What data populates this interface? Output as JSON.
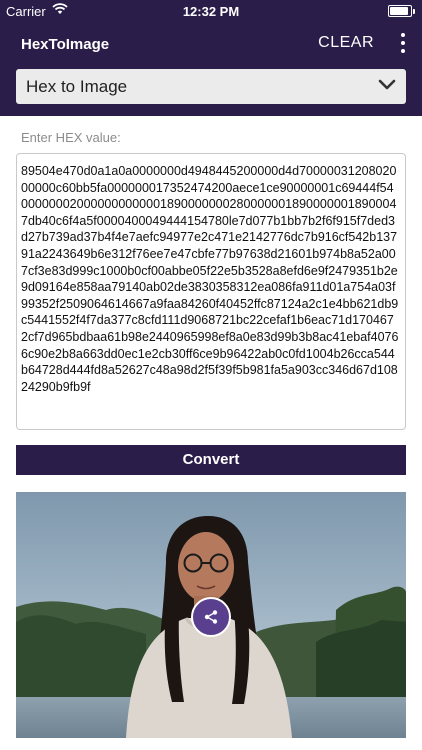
{
  "status_bar": {
    "carrier": "Carrier",
    "time": "12:32 PM",
    "battery_level": 0.9
  },
  "app_bar": {
    "title": "HexToImage",
    "clear_label": "CLEAR",
    "menu_icon": "more-vertical-icon"
  },
  "mode_select": {
    "selected": "Hex to Image",
    "icon": "chevron-down-icon"
  },
  "hex_input": {
    "label": "Enter HEX value:",
    "value": "89504e470d0a1a0a0000000d4948445200000d4d7000003120802000000c60bb5fa000000017352474200aece1ce90000001c69444f540000000200000000000018900000002800000018900000018900047db40c6f4a5f0000400049444154780le7d077b1bb7b2f6f915f7ded3d27b739ad37b4f4e7aefc94977e2c471e2142776dc7b916cf542b13791a2243649b6e312f76ee7e47cbfe77b97638d21601b974b8a52a007cf3e83d999c1000b0cf00abbe05f22e5b3528a8efd6e9f2479351b2e9d09164e858aa79140ab02de3830358312ea086fa911d01a754a03f99352f2509064614667a9faa84260f40452ffc87124a2c1e4bb621db9c5441552f4f7da377c8cfd111d9068721bc22cefaf1b6eac71d1704672cf7d965bdbaa61b98e2440965998ef8a0e83d99b3b8ac41ebaf40766c90e2b8a663dd0ec1e2cb30ff6ce9b96422ab0c0fd1004b26cca544b64728d444fd8a52627c48a98d2f5f39f5b981fa5a903cc346d67d10824290b9fb9f"
  },
  "convert_button": {
    "label": "Convert"
  },
  "result": {
    "share_icon": "share-icon"
  }
}
